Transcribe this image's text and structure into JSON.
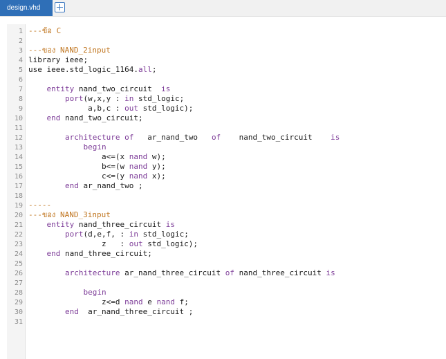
{
  "tab": {
    "file_name": "design.vhd",
    "add_icon": "plus-square-icon"
  },
  "colors": {
    "tab_bg": "#2f6fb7",
    "keyword": "#7d3c98",
    "comment": "#c0751f",
    "text": "#1a1a1a"
  },
  "code_lines": [
    [
      [
        "---ข้อ C",
        "cm"
      ]
    ],
    [],
    [
      [
        "---ของ NAND_2input",
        "cm"
      ]
    ],
    [
      [
        "library ieee;",
        ""
      ]
    ],
    [
      [
        "use ieee.std_logic_1164.",
        ""
      ],
      [
        "all",
        "kw"
      ],
      [
        ";",
        ""
      ]
    ],
    [],
    [
      [
        "    ",
        ""
      ],
      [
        "entity",
        "kw"
      ],
      [
        " nand_two_circuit  ",
        ""
      ],
      [
        "is",
        "kw"
      ]
    ],
    [
      [
        "        ",
        ""
      ],
      [
        "port",
        "kw"
      ],
      [
        "(w,x,y : ",
        ""
      ],
      [
        "in",
        "kw"
      ],
      [
        " std_logic;",
        ""
      ]
    ],
    [
      [
        "             a,b,c : ",
        ""
      ],
      [
        "out",
        "kw"
      ],
      [
        " std_logic);",
        ""
      ]
    ],
    [
      [
        "    ",
        ""
      ],
      [
        "end",
        "kw"
      ],
      [
        " nand_two_circuit;",
        ""
      ]
    ],
    [],
    [
      [
        "        ",
        ""
      ],
      [
        "architecture",
        "kw"
      ],
      [
        " ",
        ""
      ],
      [
        "of",
        "kw"
      ],
      [
        "   ar_nand_two   ",
        ""
      ],
      [
        "of",
        "kw"
      ],
      [
        "    nand_two_circuit    ",
        ""
      ],
      [
        "is",
        "kw"
      ]
    ],
    [
      [
        "            ",
        ""
      ],
      [
        "begin",
        "kw"
      ]
    ],
    [
      [
        "                a<=(x ",
        ""
      ],
      [
        "nand",
        "kw"
      ],
      [
        " w);",
        ""
      ]
    ],
    [
      [
        "                b<=(w ",
        ""
      ],
      [
        "nand",
        "kw"
      ],
      [
        " y);",
        ""
      ]
    ],
    [
      [
        "                c<=(y ",
        ""
      ],
      [
        "nand",
        "kw"
      ],
      [
        " x);",
        ""
      ]
    ],
    [
      [
        "        ",
        ""
      ],
      [
        "end",
        "kw"
      ],
      [
        " ar_nand_two ;",
        ""
      ]
    ],
    [],
    [
      [
        "-----",
        "cm"
      ]
    ],
    [
      [
        "---ของ NAND_3input",
        "cm"
      ]
    ],
    [
      [
        "    ",
        ""
      ],
      [
        "entity",
        "kw"
      ],
      [
        " nand_three_circuit ",
        ""
      ],
      [
        "is",
        "kw"
      ]
    ],
    [
      [
        "        ",
        ""
      ],
      [
        "port",
        "kw"
      ],
      [
        "(d,e,f, : ",
        ""
      ],
      [
        "in",
        "kw"
      ],
      [
        " std_logic;",
        ""
      ]
    ],
    [
      [
        "                z   : ",
        ""
      ],
      [
        "out",
        "kw"
      ],
      [
        " std_logic);",
        ""
      ]
    ],
    [
      [
        "    ",
        ""
      ],
      [
        "end",
        "kw"
      ],
      [
        " nand_three_circuit;",
        ""
      ]
    ],
    [],
    [
      [
        "        ",
        ""
      ],
      [
        "architecture",
        "kw"
      ],
      [
        " ar_nand_three_circuit ",
        ""
      ],
      [
        "of",
        "kw"
      ],
      [
        " nand_three_circuit ",
        ""
      ],
      [
        "is",
        "kw"
      ]
    ],
    [],
    [
      [
        "            ",
        ""
      ],
      [
        "begin",
        "kw"
      ]
    ],
    [
      [
        "                z<=d ",
        ""
      ],
      [
        "nand",
        "kw"
      ],
      [
        " e ",
        ""
      ],
      [
        "nand",
        "kw"
      ],
      [
        " f;",
        ""
      ]
    ],
    [
      [
        "        ",
        ""
      ],
      [
        "end",
        "kw"
      ],
      [
        "  ar_nand_three_circuit ;",
        ""
      ]
    ],
    []
  ]
}
